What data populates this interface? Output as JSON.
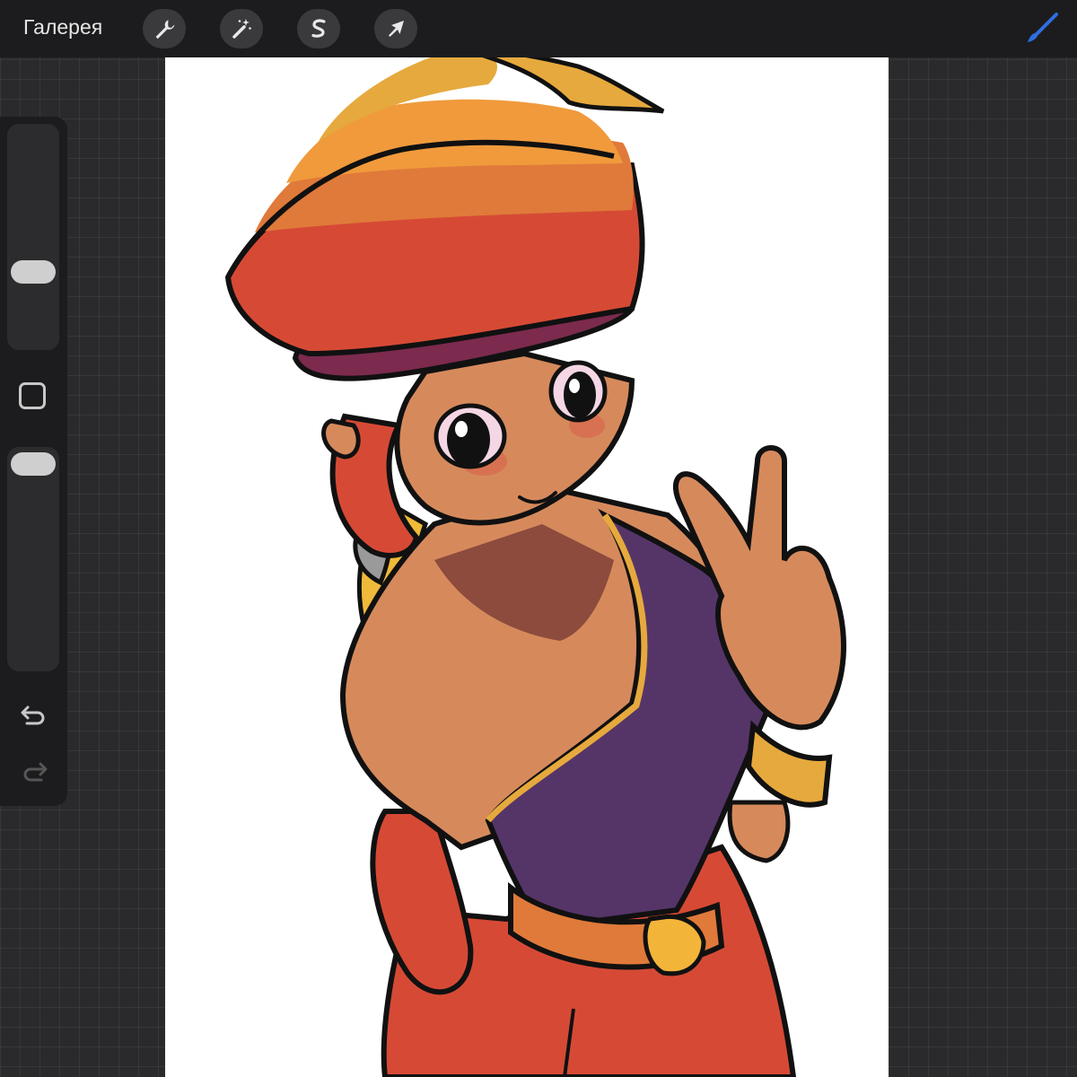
{
  "topbar": {
    "gallery_label": "Галерея",
    "tools": [
      {
        "name": "actions",
        "icon": "wrench-icon"
      },
      {
        "name": "adjustments",
        "icon": "magic-wand-icon"
      },
      {
        "name": "selection",
        "icon": "selection-s-icon"
      },
      {
        "name": "transform",
        "icon": "arrow-cursor-icon"
      }
    ],
    "active_tool": {
      "name": "brush",
      "icon": "brush-icon",
      "color": "#2f6de1"
    }
  },
  "sidebar": {
    "brush_size": 0.5,
    "brush_opacity": 0.05,
    "icons": [
      "modify-square-icon",
      "undo-icon",
      "redo-icon"
    ]
  },
  "colors": {
    "ui_bar": "#1c1c1e",
    "ui_button": "#3a3a3c",
    "canvas_bg": "#ffffff",
    "accent": "#2f6de1"
  }
}
